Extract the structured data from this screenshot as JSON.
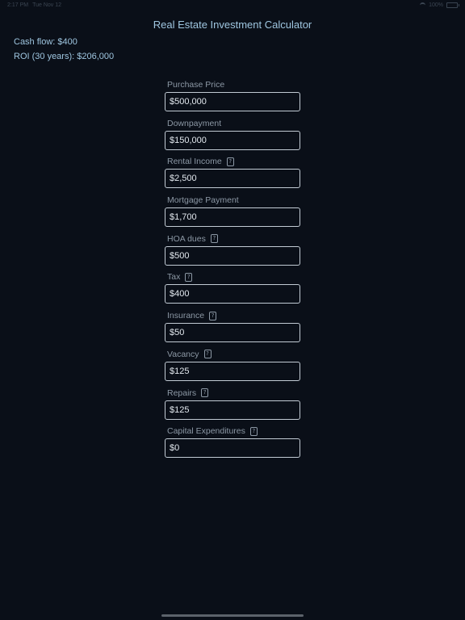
{
  "status_bar": {
    "time": "2:17 PM",
    "date": "Tue Nov 12",
    "battery": "100%"
  },
  "app": {
    "title": "Real Estate Investment Calculator"
  },
  "summary": {
    "cash_flow": "Cash flow: $400",
    "roi": "ROI (30 years): $206,000"
  },
  "form": {
    "fields": [
      {
        "label": "Purchase Price",
        "value": "$500,000",
        "help": false
      },
      {
        "label": "Downpayment",
        "value": "$150,000",
        "help": false
      },
      {
        "label": "Rental Income",
        "value": "$2,500",
        "help": true
      },
      {
        "label": "Mortgage Payment",
        "value": "$1,700",
        "help": false
      },
      {
        "label": "HOA dues",
        "value": "$500",
        "help": true
      },
      {
        "label": "Tax",
        "value": "$400",
        "help": true
      },
      {
        "label": "Insurance",
        "value": "$50",
        "help": true
      },
      {
        "label": "Vacancy",
        "value": "$125",
        "help": true
      },
      {
        "label": "Repairs",
        "value": "$125",
        "help": true
      },
      {
        "label": "Capital Expenditures",
        "value": "$0",
        "help": true
      }
    ]
  },
  "help_glyph": "?",
  "colors": {
    "background": "#0a0f18",
    "accent": "#9fc6e0",
    "label": "#8c98a5",
    "input_border": "#c2cbd4"
  }
}
